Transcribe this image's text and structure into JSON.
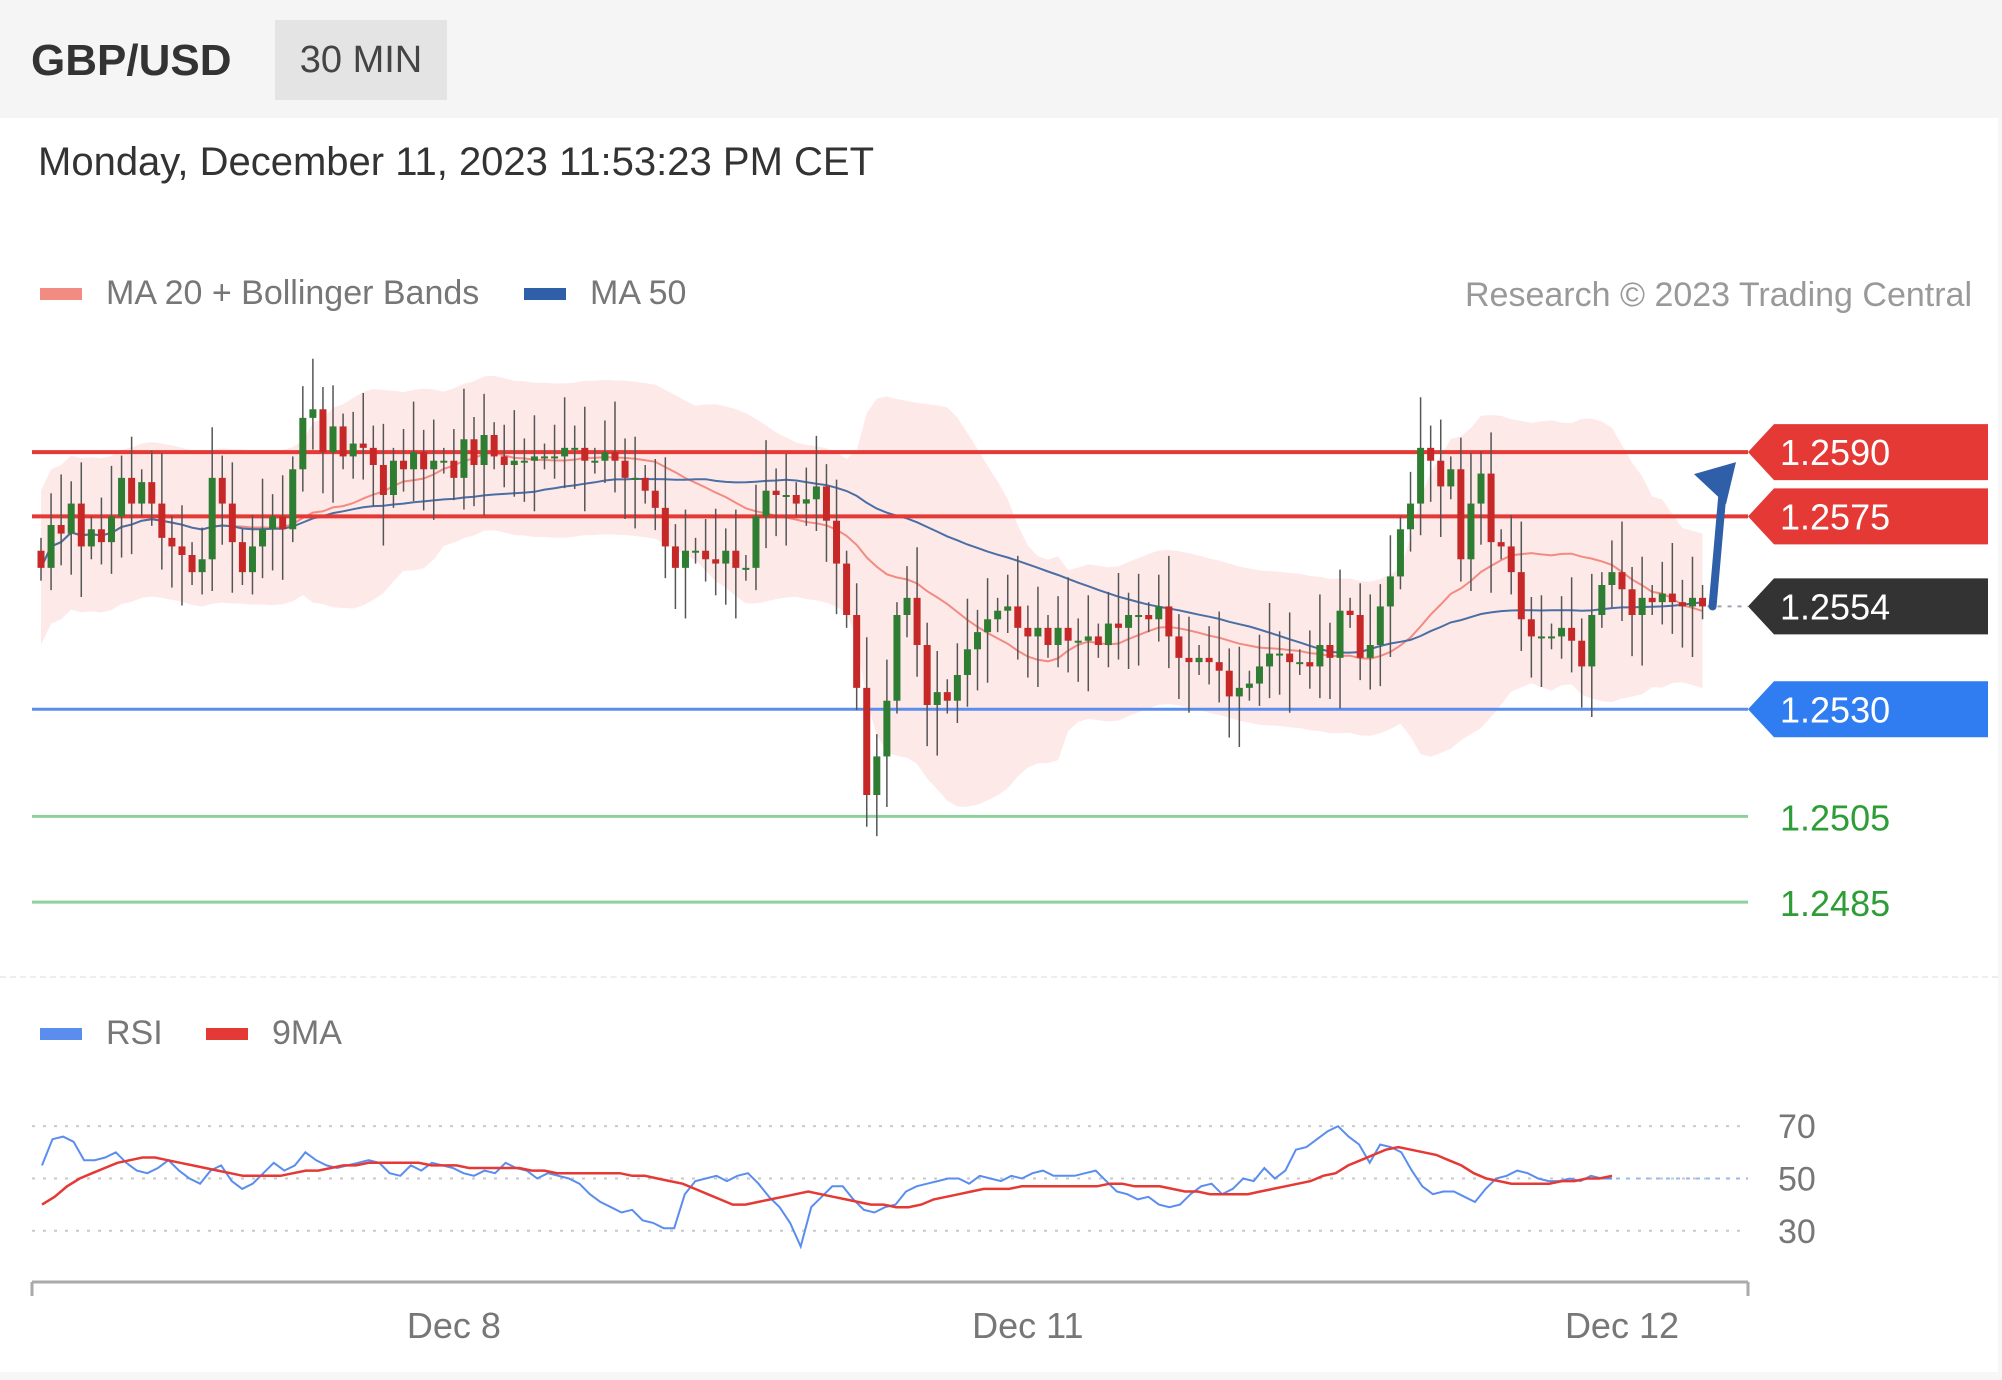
{
  "header": {
    "symbol": "GBP/USD",
    "timeframe": "30 MIN"
  },
  "datetime": "Monday, December 11, 2023 11:53:23 PM CET",
  "legend": {
    "ma20_label": "MA 20 + Bollinger Bands",
    "ma50_label": "MA 50",
    "copyright": "Research © 2023 Trading Central"
  },
  "rsi_legend": {
    "rsi_label": "RSI",
    "ma9_label": "9MA"
  },
  "colors": {
    "up_candle": "#2e7d32",
    "down_candle": "#c62828",
    "resistance": "#e53935",
    "pivot": "#5b8def",
    "support": "#8fd19e",
    "support_text": "#2e9d36",
    "last_price_bg": "#333333",
    "bollinger_fill": "#fde2e2",
    "ma20": "#f28b82",
    "ma50": "#4a6fa5",
    "arrow": "#2f5fa8",
    "rsi_line": "#5b8def",
    "rsi_ma": "#e53935"
  },
  "chart_data": [
    {
      "type": "candlestick",
      "title": "GBP/USD",
      "price_levels": [
        {
          "value": "1.2590",
          "role": "resistance"
        },
        {
          "value": "1.2575",
          "role": "resistance"
        },
        {
          "value": "1.2554",
          "role": "last"
        },
        {
          "value": "1.2530",
          "role": "pivot"
        },
        {
          "value": "1.2505",
          "role": "support"
        },
        {
          "value": "1.2485",
          "role": "support"
        }
      ],
      "ylim": [
        1.2475,
        1.2615
      ],
      "x_ticks": [
        "Dec 8",
        "Dec 11",
        "Dec 12"
      ],
      "x_tick_index": [
        41,
        98,
        157
      ],
      "overlays": [
        "MA 20 + Bollinger Bands",
        "MA 50"
      ],
      "forecast": "bullish",
      "close": [
        1.2563,
        1.2573,
        1.2571,
        1.2578,
        1.2568,
        1.2572,
        1.2569,
        1.2575,
        1.2584,
        1.2578,
        1.2583,
        1.2578,
        1.257,
        1.2568,
        1.2566,
        1.2562,
        1.2565,
        1.2584,
        1.2578,
        1.2569,
        1.2562,
        1.2568,
        1.2572,
        1.2575,
        1.2572,
        1.2586,
        1.2598,
        1.26,
        1.259,
        1.2596,
        1.2589,
        1.2592,
        1.2591,
        1.2587,
        1.258,
        1.2588,
        1.2586,
        1.259,
        1.2586,
        1.2588,
        1.2588,
        1.2584,
        1.2593,
        1.2587,
        1.2594,
        1.2589,
        1.2587,
        1.2588,
        1.2588,
        1.2589,
        1.2589,
        1.2589,
        1.2591,
        1.2591,
        1.2588,
        1.2588,
        1.259,
        1.2588,
        1.2584,
        1.2584,
        1.2581,
        1.2577,
        1.2568,
        1.2563,
        1.2567,
        1.2567,
        1.2565,
        1.2564,
        1.2567,
        1.2563,
        1.2563,
        1.2575,
        1.2581,
        1.258,
        1.258,
        1.2578,
        1.2579,
        1.2582,
        1.2574,
        1.2564,
        1.2552,
        1.2535,
        1.251,
        1.2519,
        1.2532,
        1.2552,
        1.2556,
        1.2545,
        1.2531,
        1.2534,
        1.2532,
        1.2538,
        1.2544,
        1.2548,
        1.2551,
        1.2553,
        1.2554,
        1.2549,
        1.2547,
        1.2549,
        1.2545,
        1.2549,
        1.2546,
        1.2546,
        1.2547,
        1.2545,
        1.255,
        1.2549,
        1.2552,
        1.2552,
        1.2551,
        1.2554,
        1.2547,
        1.2542,
        1.2541,
        1.2542,
        1.2541,
        1.2539,
        1.2533,
        1.2535,
        1.2536,
        1.254,
        1.2543,
        1.2543,
        1.2541,
        1.2541,
        1.254,
        1.2545,
        1.2542,
        1.2553,
        1.2552,
        1.2542,
        1.2545,
        1.2554,
        1.2561,
        1.2572,
        1.2578,
        1.2591,
        1.2588,
        1.2582,
        1.2586,
        1.2565,
        1.2578,
        1.2585,
        1.2569,
        1.2568,
        1.2562,
        1.2551,
        1.2547,
        1.2547,
        1.2547,
        1.2549,
        1.2546,
        1.254,
        1.2552,
        1.2559,
        1.2562,
        1.2558,
        1.2552,
        1.2556,
        1.2555,
        1.2557,
        1.2555,
        1.2554,
        1.2556,
        1.2554
      ]
    },
    {
      "type": "line",
      "title": "RSI",
      "series": [
        {
          "name": "RSI",
          "values": [
            55,
            65,
            66,
            64,
            57,
            57,
            58,
            60,
            56,
            53,
            52,
            54,
            57,
            53,
            50,
            48,
            53,
            55,
            49,
            46,
            48,
            52,
            56,
            53,
            55,
            60,
            57,
            55,
            54,
            55,
            56,
            57,
            56,
            52,
            51,
            55,
            53,
            56,
            55,
            54,
            52,
            51,
            53,
            52,
            56,
            54,
            53,
            50,
            52,
            51,
            50,
            48,
            44,
            41,
            39,
            37,
            38,
            34,
            33,
            31,
            31,
            44,
            49,
            50,
            51,
            49,
            51,
            52,
            48,
            43,
            39,
            33,
            24,
            39,
            43,
            47,
            47,
            42,
            38,
            37,
            39,
            40,
            45,
            47,
            48,
            49,
            50,
            50,
            48,
            51,
            50,
            49,
            51,
            50,
            52,
            53,
            51,
            51,
            51,
            52,
            53,
            49,
            45,
            44,
            42,
            43,
            40,
            39,
            40,
            44,
            47,
            48,
            44,
            46,
            50,
            49,
            54,
            50,
            53,
            61,
            62,
            65,
            68,
            70,
            66,
            63,
            56,
            63,
            62,
            60,
            53,
            47,
            44,
            45,
            45,
            43,
            41,
            46,
            50,
            51,
            53,
            52,
            50,
            49,
            49,
            50,
            49,
            51,
            50,
            50
          ]
        },
        {
          "name": "9MA",
          "values": [
            40,
            43,
            47,
            50,
            52,
            54,
            56,
            57,
            58,
            58,
            57,
            56,
            55,
            54,
            53,
            52,
            51,
            51,
            51,
            51,
            52,
            53,
            53,
            54,
            55,
            55,
            56,
            56,
            56,
            56,
            56,
            55,
            55,
            55,
            54,
            54,
            54,
            54,
            54,
            53,
            53,
            52,
            52,
            52,
            52,
            52,
            52,
            51,
            51,
            50,
            49,
            48,
            46,
            44,
            42,
            40,
            40,
            41,
            42,
            43,
            44,
            45,
            44,
            43,
            42,
            41,
            40,
            40,
            39,
            39,
            40,
            42,
            43,
            44,
            45,
            46,
            46,
            46,
            47,
            47,
            47,
            47,
            47,
            47,
            47,
            48,
            48,
            47,
            47,
            47,
            46,
            45,
            45,
            44,
            44,
            44,
            44,
            45,
            46,
            47,
            48,
            49,
            51,
            52,
            55,
            57,
            59,
            61,
            62,
            61,
            60,
            59,
            57,
            55,
            52,
            50,
            49,
            48,
            48,
            48,
            48,
            49,
            49,
            50,
            50,
            51
          ]
        }
      ],
      "ylim": [
        15,
        80
      ],
      "y_ticks": [
        "70",
        "50",
        "30"
      ]
    }
  ]
}
